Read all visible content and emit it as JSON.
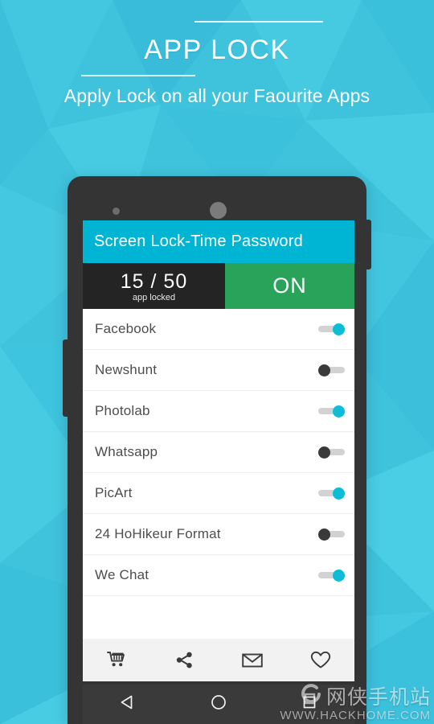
{
  "promo": {
    "title": "APP LOCK",
    "subtitle": "Apply Lock on all your Faourite Apps",
    "bg_color": "#3fc3dd",
    "text_color": "#ffffff"
  },
  "phone": {
    "body_color": "#343434",
    "bezel_sensor": "proximity-sensor",
    "bezel_speaker": "earpiece-speaker"
  },
  "app": {
    "app_bar": {
      "title": "Screen Lock-Time Password",
      "color": "#00b5d4"
    },
    "status": {
      "counter": "15 / 50",
      "caption": "app locked",
      "counter_bg": "#242424",
      "toggle_label": "ON",
      "toggle_bg": "#28a359"
    },
    "list": [
      {
        "name": "Facebook",
        "locked": true
      },
      {
        "name": "Newshunt",
        "locked": false
      },
      {
        "name": "Photolab",
        "locked": true
      },
      {
        "name": "Whatsapp",
        "locked": false
      },
      {
        "name": "PicArt",
        "locked": true
      },
      {
        "name": "24 HoHikeur Format",
        "locked": false
      },
      {
        "name": "We Chat",
        "locked": true
      }
    ],
    "toggle_on_color": "#0fbcd8",
    "toggle_off_color": "#3a3a3a",
    "toolbar": [
      {
        "icon": "shopping-cart-icon",
        "label": "Store"
      },
      {
        "icon": "share-icon",
        "label": "Share"
      },
      {
        "icon": "envelope-icon",
        "label": "Mail"
      },
      {
        "icon": "heart-icon",
        "label": "Favorite"
      }
    ]
  },
  "navbar": [
    {
      "icon": "back-triangle-icon",
      "label": "Back"
    },
    {
      "icon": "home-circle-icon",
      "label": "Home"
    },
    {
      "icon": "recents-square-icon",
      "label": "Recents"
    }
  ],
  "watermark": {
    "chinese": "网侠手机站",
    "url": "WWW.HACKHOME.COM"
  }
}
